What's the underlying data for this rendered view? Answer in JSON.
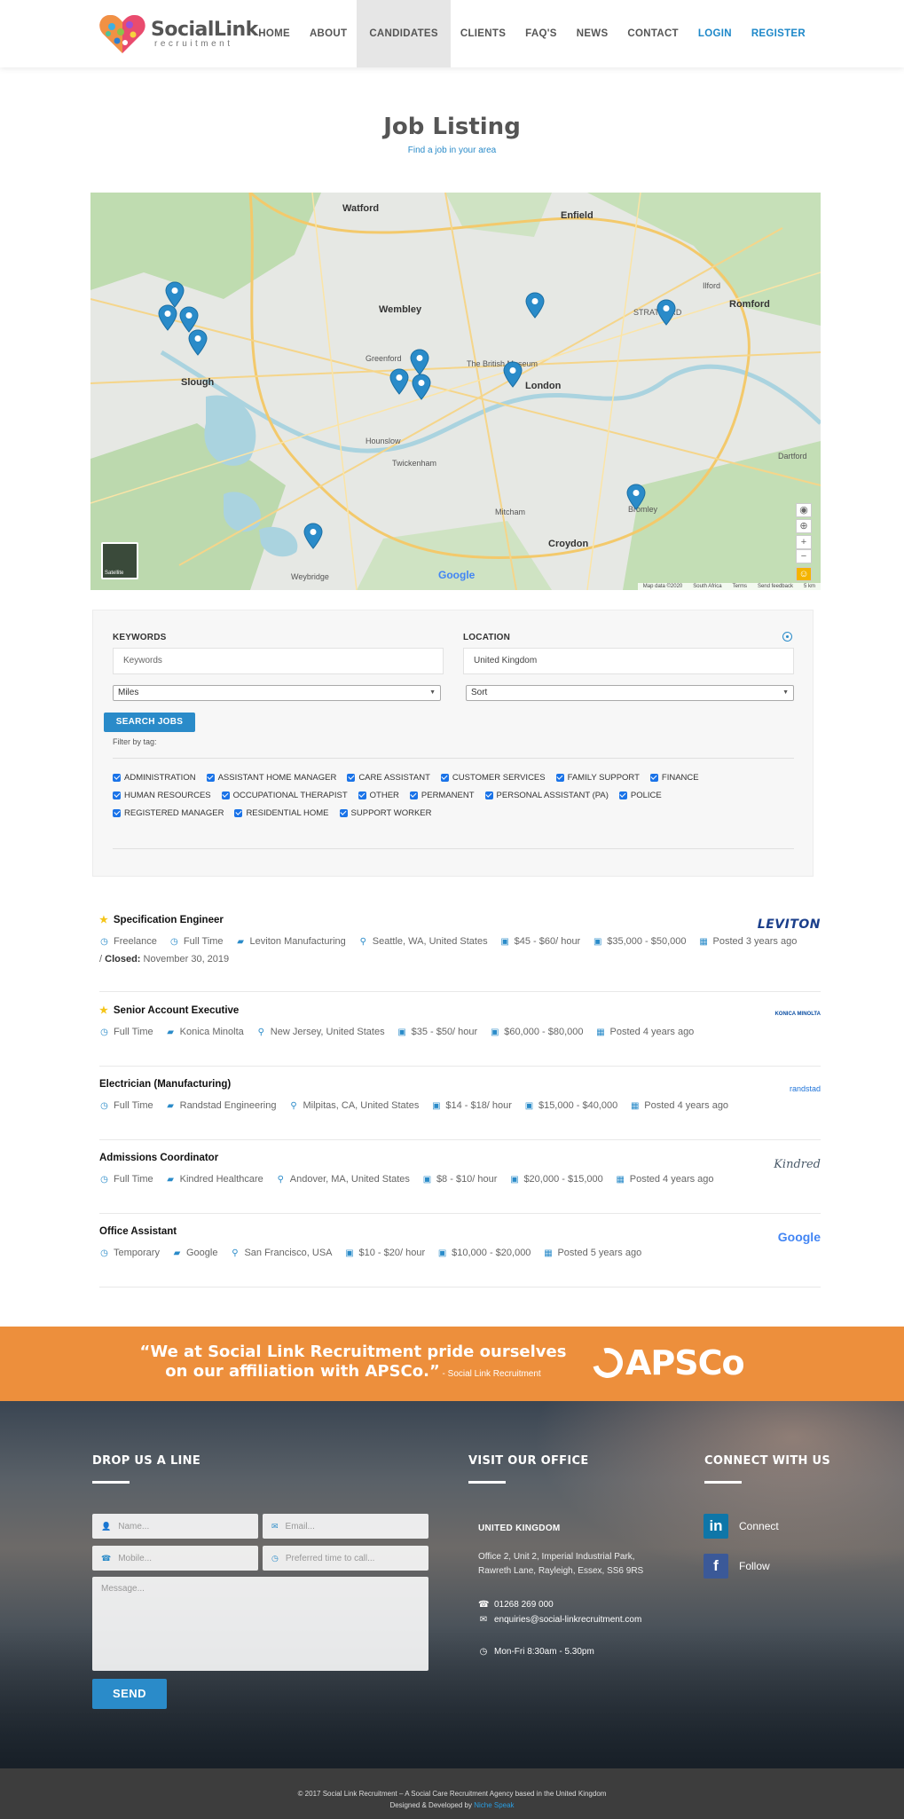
{
  "brand": {
    "name": "SocialLink",
    "tagline": "recruitment"
  },
  "nav": [
    {
      "label": "HOME",
      "active": false,
      "accent": false
    },
    {
      "label": "ABOUT",
      "active": false,
      "accent": false
    },
    {
      "label": "CANDIDATES",
      "active": true,
      "accent": false
    },
    {
      "label": "CLIENTS",
      "active": false,
      "accent": false
    },
    {
      "label": "FAQ'S",
      "active": false,
      "accent": false
    },
    {
      "label": "NEWS",
      "active": false,
      "accent": false
    },
    {
      "label": "CONTACT",
      "active": false,
      "accent": false
    },
    {
      "label": "LOGIN",
      "active": false,
      "accent": true
    },
    {
      "label": "REGISTER",
      "active": false,
      "accent": true
    }
  ],
  "page": {
    "title": "Job Listing",
    "subtitle": "Find a job in your area"
  },
  "map": {
    "labels": {
      "london": "London",
      "watford": "Watford",
      "enfield": "Enfield",
      "wembley": "Wembley",
      "slough": "Slough",
      "croydon": "Croydon",
      "romford": "Romford",
      "bromley": "Bromley",
      "twickenham": "Twickenham",
      "hounslow": "Hounslow",
      "mitcham": "Mitcham",
      "stratford": "STRATFORD",
      "british_museum": "The British Museum",
      "greenford": "Greenford",
      "weybridge": "Weybridge",
      "dartford": "Dartford",
      "ilford": "Ilford"
    },
    "satellite_label": "Satellite",
    "footer": [
      "Map data ©2020",
      "South Africa",
      "Terms",
      "Send feedback",
      "5 km"
    ],
    "pin_color": "#2a8bc9"
  },
  "search": {
    "keywords_label": "KEYWORDS",
    "keywords_placeholder": "Keywords",
    "location_label": "LOCATION",
    "location_value": "United Kingdom",
    "distance_select": "Miles",
    "sort_select": "Sort",
    "search_button": "SEARCH JOBS",
    "filter_label": "Filter by tag:",
    "tags": [
      [
        "ADMINISTRATION",
        "ASSISTANT HOME MANAGER",
        "CARE ASSISTANT",
        "CUSTOMER SERVICES",
        "FAMILY SUPPORT",
        "FINANCE"
      ],
      [
        "HUMAN RESOURCES",
        "OCCUPATIONAL THERAPIST",
        "OTHER",
        "PERMANENT",
        "PERSONAL ASSISTANT (PA)",
        "POLICE"
      ],
      [
        "REGISTERED MANAGER",
        "RESIDENTIAL HOME",
        "SUPPORT WORKER"
      ]
    ]
  },
  "jobs": [
    {
      "title": "Specification Engineer",
      "featured": true,
      "meta": [
        {
          "icon": "clock-icon",
          "text": "Freelance"
        },
        {
          "icon": "clock-icon",
          "text": "Full Time"
        },
        {
          "icon": "briefcase-icon",
          "text": "Leviton Manufacturing"
        },
        {
          "icon": "location-icon",
          "text": "Seattle, WA, United States"
        },
        {
          "icon": "money-icon",
          "text": "$45 - $60/ hour"
        },
        {
          "icon": "money-icon",
          "text": "$35,000 - $50,000"
        },
        {
          "icon": "calendar-icon",
          "text": "Posted 3 years ago"
        }
      ],
      "closed_label": "Closed:",
      "closed_date": "November 30, 2019",
      "logo": "LEVITON",
      "logo_color": "#1b3f8b"
    },
    {
      "title": "Senior Account Executive",
      "featured": true,
      "meta": [
        {
          "icon": "clock-icon",
          "text": "Full Time"
        },
        {
          "icon": "briefcase-icon",
          "text": "Konica Minolta"
        },
        {
          "icon": "location-icon",
          "text": "New Jersey, United States"
        },
        {
          "icon": "money-icon",
          "text": "$35 - $50/ hour"
        },
        {
          "icon": "money-icon",
          "text": "$60,000 - $80,000"
        },
        {
          "icon": "calendar-icon",
          "text": "Posted 4 years ago"
        }
      ],
      "logo": "KONICA MINOLTA",
      "logo_color": "#0a4ea3"
    },
    {
      "title": "Electrician (Manufacturing)",
      "featured": false,
      "meta": [
        {
          "icon": "clock-icon",
          "text": "Full Time"
        },
        {
          "icon": "briefcase-icon",
          "text": "Randstad Engineering"
        },
        {
          "icon": "location-icon",
          "text": "Milpitas, CA, United States"
        },
        {
          "icon": "money-icon",
          "text": "$14 - $18/ hour"
        },
        {
          "icon": "money-icon",
          "text": "$15,000 - $40,000"
        },
        {
          "icon": "calendar-icon",
          "text": "Posted 4 years ago"
        }
      ],
      "logo": "randstad",
      "logo_color": "#2175d9"
    },
    {
      "title": "Admissions Coordinator",
      "featured": false,
      "meta": [
        {
          "icon": "clock-icon",
          "text": "Full Time"
        },
        {
          "icon": "briefcase-icon",
          "text": "Kindred Healthcare"
        },
        {
          "icon": "location-icon",
          "text": "Andover, MA, United States"
        },
        {
          "icon": "money-icon",
          "text": "$8 - $10/ hour"
        },
        {
          "icon": "money-icon",
          "text": "$20,000 - $15,000"
        },
        {
          "icon": "calendar-icon",
          "text": "Posted 4 years ago"
        }
      ],
      "logo": "Kindred",
      "logo_color": "#4a5a6a"
    },
    {
      "title": "Office Assistant",
      "featured": false,
      "meta": [
        {
          "icon": "clock-icon",
          "text": "Temporary"
        },
        {
          "icon": "briefcase-icon",
          "text": "Google"
        },
        {
          "icon": "location-icon",
          "text": "San Francisco, USA"
        },
        {
          "icon": "money-icon",
          "text": "$10 - $20/ hour"
        },
        {
          "icon": "money-icon",
          "text": "$10,000 - $20,000"
        },
        {
          "icon": "calendar-icon",
          "text": "Posted 5 years ago"
        }
      ],
      "logo": "Google",
      "logo_color": "#4285f4"
    }
  ],
  "banner": {
    "quote_line1": "“We at Social Link Recruitment pride ourselves",
    "quote_line2": "on our affiliation with APSCo.”",
    "attribution": " - Social Link Recruitment",
    "logo": "APSCo",
    "bg": "#ed8f3c"
  },
  "footer": {
    "contact_heading": "DROP US A LINE",
    "office_heading": "VISIT OUR OFFICE",
    "social_heading": "CONNECT WITH US",
    "name_placeholder": "Name...",
    "email_placeholder": "Email...",
    "mobile_placeholder": "Mobile...",
    "time_placeholder": "Preferred time to call...",
    "message_placeholder": "Message...",
    "send_button": "SEND",
    "office_country": "UNITED KINGDOM",
    "office_address_1": "Office 2, Unit 2, Imperial Industrial Park,",
    "office_address_2": "Rawreth Lane, Rayleigh, Essex, SS6 9RS",
    "phone": "01268 269 000",
    "email": "enquiries@social-linkrecruitment.com",
    "hours": "Mon-Fri 8:30am - 5.30pm",
    "linkedin_label": "Connect",
    "facebook_label": "Follow"
  },
  "copyright": {
    "line1": "© 2017 Social Link Recruitment – A Social Care Recruitment Agency based in the United Kingdom",
    "line2_prefix": "Designed & Developed by ",
    "developer": "Niche Speak"
  }
}
